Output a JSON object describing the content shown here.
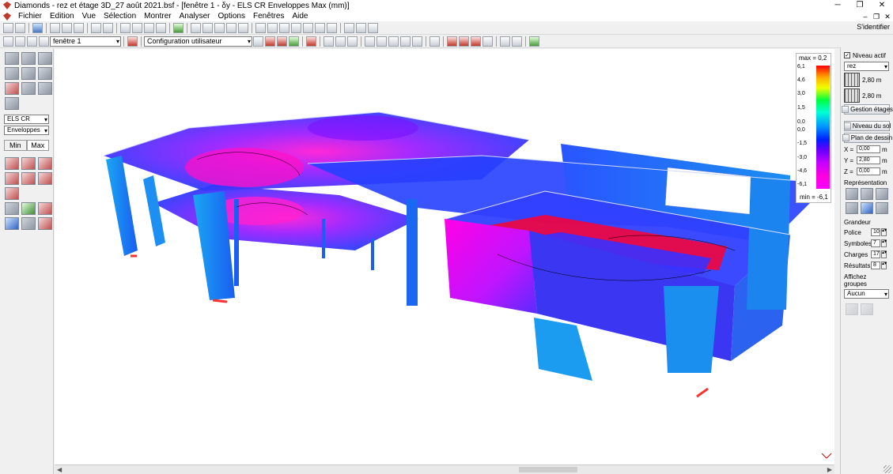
{
  "window": {
    "title": "Diamonds - rez et étage 3D_27 août 2021.bsf - [fenêtre 1 - δy - ELS CR Enveloppes Max  (mm)]",
    "minimize": "─",
    "restore": "❐",
    "close": "✕"
  },
  "menu": {
    "items": [
      "Fichier",
      "Edition",
      "Vue",
      "Sélection",
      "Montrer",
      "Analyser",
      "Options",
      "Fenêtres",
      "Aide"
    ],
    "doc_minimize": "‒",
    "doc_restore": "❐",
    "doc_close": "✕"
  },
  "account": {
    "label": "S'identifier"
  },
  "toolbar2": {
    "window_combo": "fenêtre 1",
    "config_combo": "Configuration utilisateur"
  },
  "left_panel": {
    "load_case_combo": "ELS CR",
    "envelope_combo": "Enveloppes",
    "tab_min": "Min",
    "tab_max": "Max"
  },
  "legend": {
    "max_label": "max = 0,2",
    "min_label": "min = -6,1",
    "ticks": [
      "6,1",
      "4,6",
      "3,0",
      "1,5",
      "0,0",
      "0,0",
      "-1,5",
      "-3,0",
      "-4,6",
      "-6,1"
    ]
  },
  "right_panel": {
    "active_level_label": "Niveau actif",
    "active_level_combo": "rez",
    "floor_height_1": "2,80 m",
    "floor_height_2": "2,80 m",
    "manage_floors": "Gestion étages",
    "ground_level": "Niveau du sol",
    "drawing_plane": "Plan de dessin",
    "x_label": "X =",
    "x_value": "0,00",
    "x_unit": "m",
    "y_label": "Y =",
    "y_value": "2,80",
    "y_unit": "m",
    "z_label": "Z =",
    "z_value": "0,00",
    "z_unit": "m",
    "representation": "Représentation",
    "grandeur": "Grandeur",
    "police_label": "Police",
    "police_value": "10",
    "symboles_label": "Symboles",
    "symboles_value": "7",
    "charges_label": "Charges",
    "charges_value": "17",
    "resultats_label": "Résultats",
    "resultats_value": "8",
    "groups_label": "Affichez groupes",
    "groups_combo": "Aucun"
  },
  "colors": {
    "contour_max": "#ff0000",
    "contour_mid": "#0050ff",
    "contour_min": "#ff00ff",
    "wall_cyan": "#1c9cf0"
  }
}
